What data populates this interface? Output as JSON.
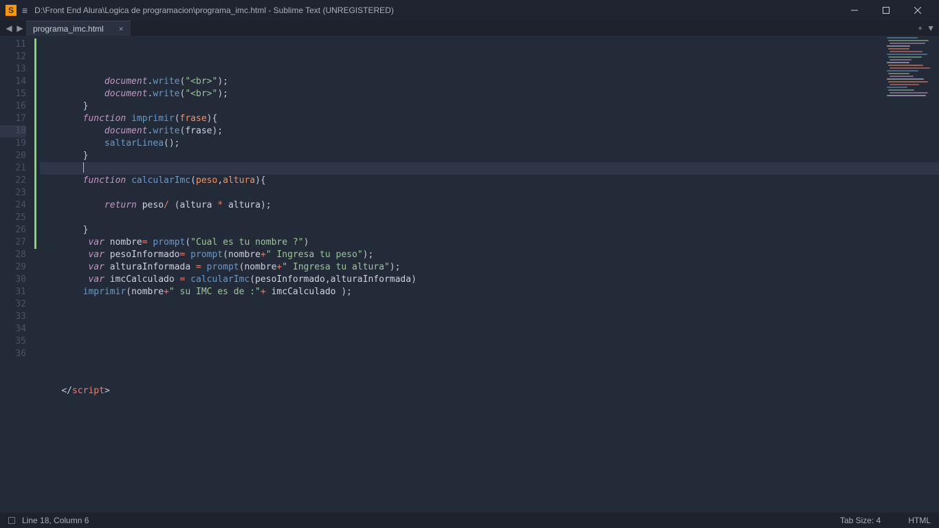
{
  "window": {
    "title": "D:\\Front End Alura\\Logica de programacion\\programa_imc.html - Sublime Text (UNREGISTERED)"
  },
  "tab": {
    "name": "programa_imc.html"
  },
  "gutter": {
    "start": 11,
    "end": 36,
    "active": 18
  },
  "code": {
    "lines": [
      {
        "n": 11,
        "seg": [
          {
            "t": "            "
          },
          {
            "c": "stor",
            "t": "document"
          },
          {
            "c": "punc",
            "t": "."
          },
          {
            "c": "func",
            "t": "write"
          },
          {
            "c": "punc",
            "t": "("
          },
          {
            "c": "str",
            "t": "\"<br>\""
          },
          {
            "c": "punc",
            "t": ");"
          }
        ]
      },
      {
        "n": 12,
        "seg": [
          {
            "t": "            "
          },
          {
            "c": "stor",
            "t": "document"
          },
          {
            "c": "punc",
            "t": "."
          },
          {
            "c": "func",
            "t": "write"
          },
          {
            "c": "punc",
            "t": "("
          },
          {
            "c": "str",
            "t": "\"<br>\""
          },
          {
            "c": "punc",
            "t": ");"
          }
        ]
      },
      {
        "n": 13,
        "seg": [
          {
            "t": "        "
          },
          {
            "c": "punc",
            "t": "}"
          }
        ]
      },
      {
        "n": 14,
        "seg": [
          {
            "t": "        "
          },
          {
            "c": "stor",
            "t": "function"
          },
          {
            "t": " "
          },
          {
            "c": "func",
            "t": "imprimir"
          },
          {
            "c": "punc",
            "t": "("
          },
          {
            "c": "param",
            "t": "frase"
          },
          {
            "c": "punc",
            "t": "){"
          }
        ]
      },
      {
        "n": 15,
        "seg": [
          {
            "t": "            "
          },
          {
            "c": "stor",
            "t": "document"
          },
          {
            "c": "punc",
            "t": "."
          },
          {
            "c": "func",
            "t": "write"
          },
          {
            "c": "punc",
            "t": "("
          },
          {
            "c": "ident",
            "t": "frase"
          },
          {
            "c": "punc",
            "t": ");"
          }
        ]
      },
      {
        "n": 16,
        "seg": [
          {
            "t": "            "
          },
          {
            "c": "func",
            "t": "saltarLinea"
          },
          {
            "c": "punc",
            "t": "();"
          }
        ]
      },
      {
        "n": 17,
        "seg": [
          {
            "t": "        "
          },
          {
            "c": "punc",
            "t": "}"
          }
        ]
      },
      {
        "n": 18,
        "active": true,
        "seg": [
          {
            "t": "        "
          },
          {
            "cursor": true
          }
        ]
      },
      {
        "n": 19,
        "seg": [
          {
            "t": "        "
          },
          {
            "c": "stor",
            "t": "function"
          },
          {
            "t": " "
          },
          {
            "c": "func",
            "t": "calcularImc"
          },
          {
            "c": "punc",
            "t": "("
          },
          {
            "c": "param",
            "t": "peso"
          },
          {
            "c": "punc",
            "t": ","
          },
          {
            "c": "param",
            "t": "altura"
          },
          {
            "c": "punc",
            "t": "){"
          }
        ]
      },
      {
        "n": 20,
        "seg": [
          {
            "t": " "
          }
        ]
      },
      {
        "n": 21,
        "seg": [
          {
            "t": "            "
          },
          {
            "c": "stor",
            "t": "return"
          },
          {
            "t": " "
          },
          {
            "c": "ident",
            "t": "peso"
          },
          {
            "c": "op",
            "t": "/"
          },
          {
            "t": " "
          },
          {
            "c": "punc",
            "t": "("
          },
          {
            "c": "ident",
            "t": "altura"
          },
          {
            "t": " "
          },
          {
            "c": "op",
            "t": "*"
          },
          {
            "t": " "
          },
          {
            "c": "ident",
            "t": "altura"
          },
          {
            "c": "punc",
            "t": ");"
          }
        ]
      },
      {
        "n": 22,
        "seg": [
          {
            "t": " "
          }
        ]
      },
      {
        "n": 23,
        "seg": [
          {
            "t": "        "
          },
          {
            "c": "punc",
            "t": "}"
          }
        ]
      },
      {
        "n": 24,
        "seg": [
          {
            "t": "         "
          },
          {
            "c": "stor",
            "t": "var"
          },
          {
            "t": " "
          },
          {
            "c": "ident",
            "t": "nombre"
          },
          {
            "c": "op",
            "t": "="
          },
          {
            "t": " "
          },
          {
            "c": "func",
            "t": "prompt"
          },
          {
            "c": "punc",
            "t": "("
          },
          {
            "c": "str",
            "t": "\"Cual es tu nombre ?\""
          },
          {
            "c": "punc",
            "t": ")"
          }
        ]
      },
      {
        "n": 25,
        "seg": [
          {
            "t": "         "
          },
          {
            "c": "stor",
            "t": "var"
          },
          {
            "t": " "
          },
          {
            "c": "ident",
            "t": "pesoInformado"
          },
          {
            "c": "op",
            "t": "="
          },
          {
            "t": " "
          },
          {
            "c": "func",
            "t": "prompt"
          },
          {
            "c": "punc",
            "t": "("
          },
          {
            "c": "ident",
            "t": "nombre"
          },
          {
            "c": "op",
            "t": "+"
          },
          {
            "c": "str",
            "t": "\" Ingresa tu peso\""
          },
          {
            "c": "punc",
            "t": ");"
          }
        ]
      },
      {
        "n": 26,
        "seg": [
          {
            "t": "         "
          },
          {
            "c": "stor",
            "t": "var"
          },
          {
            "t": " "
          },
          {
            "c": "ident",
            "t": "alturaInformada"
          },
          {
            "t": " "
          },
          {
            "c": "op",
            "t": "="
          },
          {
            "t": " "
          },
          {
            "c": "func",
            "t": "prompt"
          },
          {
            "c": "punc",
            "t": "("
          },
          {
            "c": "ident",
            "t": "nombre"
          },
          {
            "c": "op",
            "t": "+"
          },
          {
            "c": "str",
            "t": "\" Ingresa tu altura\""
          },
          {
            "c": "punc",
            "t": ");"
          }
        ]
      },
      {
        "n": 27,
        "seg": [
          {
            "t": "         "
          },
          {
            "c": "stor",
            "t": "var"
          },
          {
            "t": " "
          },
          {
            "c": "ident",
            "t": "imcCalculado"
          },
          {
            "t": " "
          },
          {
            "c": "op",
            "t": "="
          },
          {
            "t": " "
          },
          {
            "c": "func",
            "t": "calcularImc"
          },
          {
            "c": "punc",
            "t": "("
          },
          {
            "c": "ident",
            "t": "pesoInformado"
          },
          {
            "c": "punc",
            "t": ","
          },
          {
            "c": "ident",
            "t": "alturaInformada"
          },
          {
            "c": "punc",
            "t": ")"
          }
        ]
      },
      {
        "n": 28,
        "seg": [
          {
            "t": "        "
          },
          {
            "c": "func",
            "t": "imprimir"
          },
          {
            "c": "punc",
            "t": "("
          },
          {
            "c": "ident",
            "t": "nombre"
          },
          {
            "c": "op",
            "t": "+"
          },
          {
            "c": "str",
            "t": "\" su IMC es de :\""
          },
          {
            "c": "op",
            "t": "+"
          },
          {
            "t": " "
          },
          {
            "c": "ident",
            "t": "imcCalculado"
          },
          {
            "t": " "
          },
          {
            "c": "punc",
            "t": ");"
          }
        ]
      },
      {
        "n": 29,
        "seg": [
          {
            "t": " "
          }
        ]
      },
      {
        "n": 30,
        "seg": [
          {
            "t": " "
          }
        ]
      },
      {
        "n": 31,
        "seg": [
          {
            "t": " "
          }
        ]
      },
      {
        "n": 32,
        "seg": [
          {
            "t": " "
          }
        ]
      },
      {
        "n": 33,
        "seg": [
          {
            "t": " "
          }
        ]
      },
      {
        "n": 34,
        "seg": [
          {
            "t": " "
          }
        ]
      },
      {
        "n": 35,
        "seg": [
          {
            "t": " "
          }
        ]
      },
      {
        "n": 36,
        "seg": [
          {
            "t": "    "
          },
          {
            "c": "tagp",
            "t": "</"
          },
          {
            "c": "tagn",
            "t": "script"
          },
          {
            "c": "tagp",
            "t": ">"
          }
        ]
      }
    ]
  },
  "status": {
    "cursor": "Line 18, Column 6",
    "tabsize": "Tab Size: 4",
    "syntax": "HTML"
  }
}
